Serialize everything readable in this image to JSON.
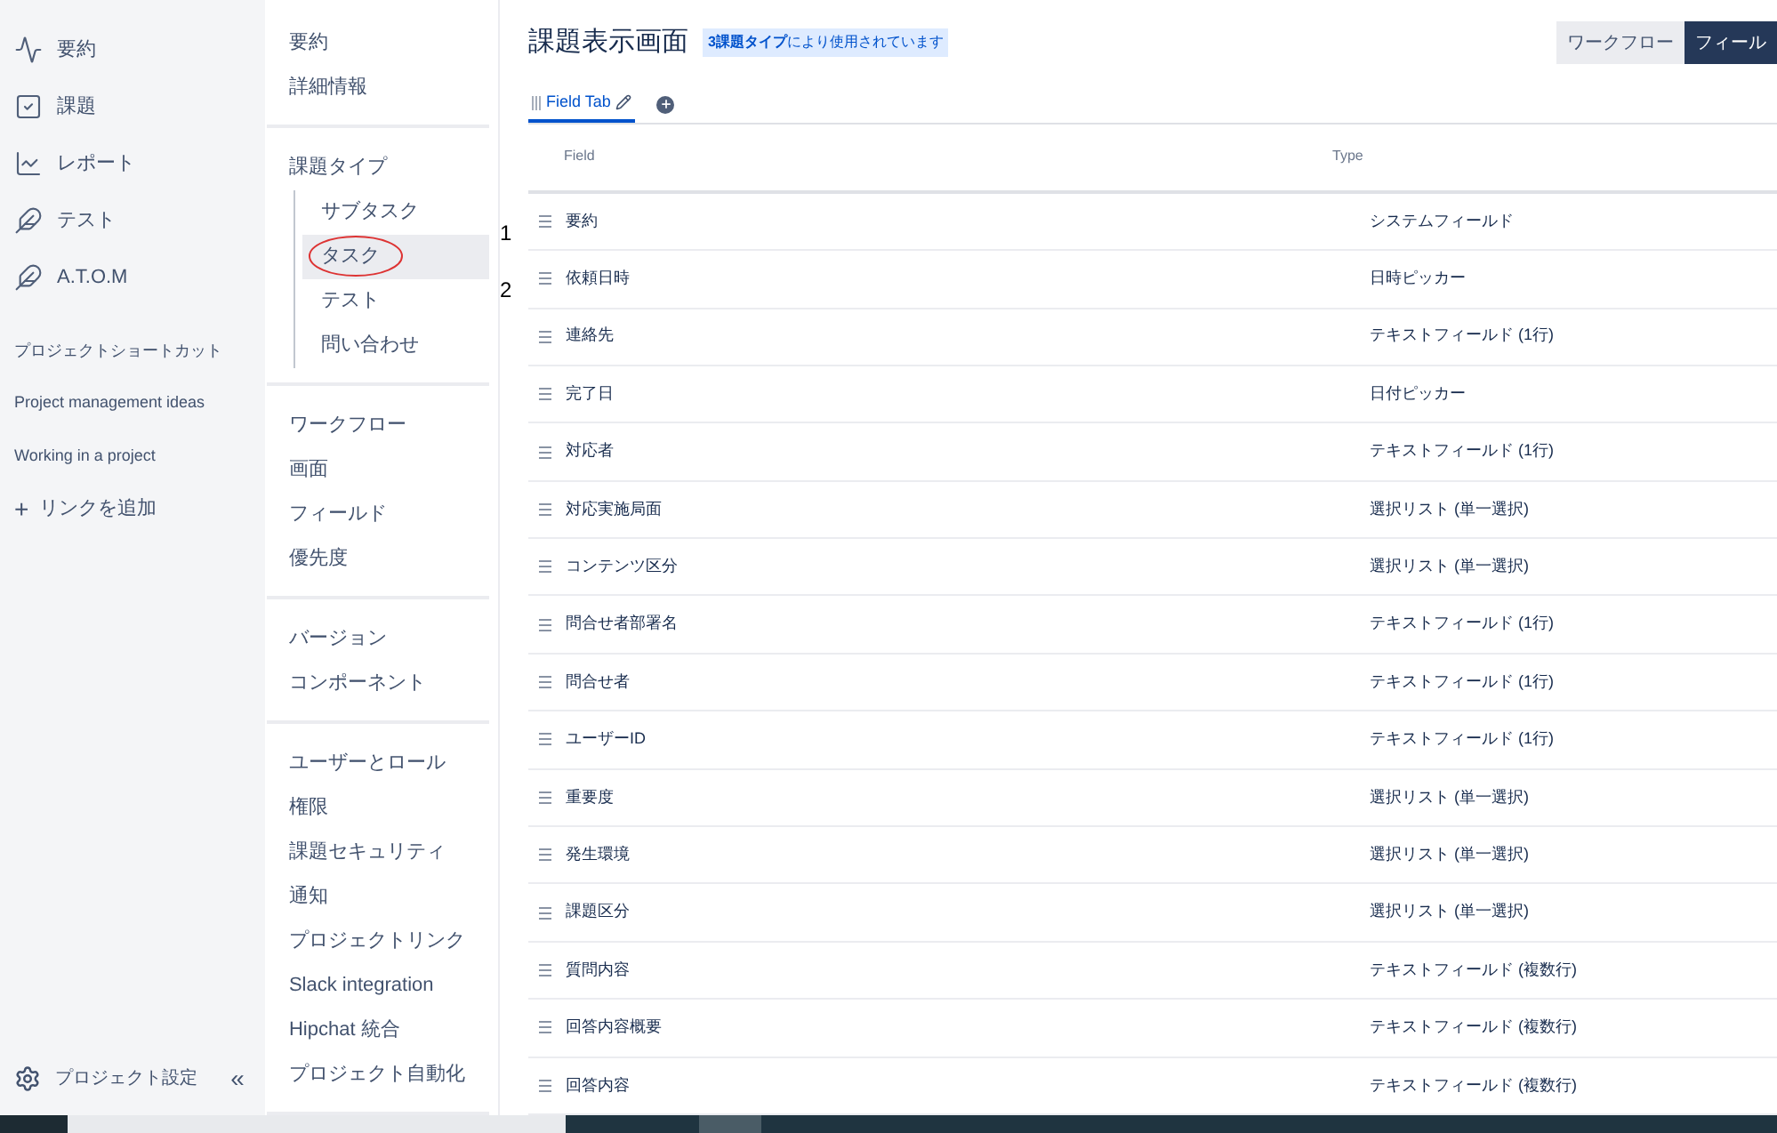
{
  "sidebar": {
    "items": [
      {
        "kind": "summary",
        "label": "要約"
      },
      {
        "kind": "issues",
        "label": "課題"
      },
      {
        "kind": "reports",
        "label": "レポート"
      },
      {
        "kind": "test",
        "label": "テスト"
      },
      {
        "kind": "atom",
        "label": "A.T.O.M"
      }
    ],
    "shortcuts_title": "プロジェクトショートカット",
    "shortcuts": [
      "Project management ideas",
      "Working in a project"
    ],
    "add_link": {
      "icon": "+",
      "label": "リンクを追加"
    },
    "settings": "プロジェクト設定",
    "collapse": "«"
  },
  "settings_nav": {
    "groups": [
      {
        "items": [
          {
            "label": "要約",
            "selected": false
          },
          {
            "label": "詳細情報",
            "selected": false
          }
        ]
      },
      {
        "items": [
          {
            "label": "課題タイプ",
            "selected": false,
            "children": [
              {
                "label": "サブタスク",
                "selected": false,
                "circled": false
              },
              {
                "label": "タスク",
                "selected": true,
                "circled": true
              },
              {
                "label": "テスト",
                "selected": false,
                "circled": false
              },
              {
                "label": "問い合わせ",
                "selected": false,
                "circled": false
              }
            ]
          }
        ]
      },
      {
        "items": [
          {
            "label": "ワークフロー",
            "selected": false
          },
          {
            "label": "画面",
            "selected": false
          },
          {
            "label": "フィールド",
            "selected": false
          },
          {
            "label": "優先度",
            "selected": false
          }
        ]
      },
      {
        "items": [
          {
            "label": "バージョン",
            "selected": false
          },
          {
            "label": "コンポーネント",
            "selected": false
          }
        ]
      },
      {
        "items": [
          {
            "label": "ユーザーとロール",
            "selected": false
          },
          {
            "label": "権限",
            "selected": false
          },
          {
            "label": "課題セキュリティ",
            "selected": false
          },
          {
            "label": "通知",
            "selected": false
          },
          {
            "label": "プロジェクトリンク",
            "selected": false
          },
          {
            "label": "Slack integration",
            "selected": false
          },
          {
            "label": "Hipchat 統合",
            "selected": false
          },
          {
            "label": "プロジェクト自動化",
            "selected": false
          }
        ]
      }
    ]
  },
  "page": {
    "title": "課題表示画面",
    "usage_badge": "**3課題タイプ**により使用されています",
    "view_toggle": [
      {
        "label": "ワークフロー",
        "selected": false
      },
      {
        "label": "フィール",
        "selected": true
      }
    ],
    "tabs": [
      {
        "label": "Field Tab",
        "selected": true
      }
    ],
    "table": {
      "columns": [
        "Field",
        "Type"
      ],
      "rows": [
        {
          "marker": "1",
          "field": "要約",
          "type": "システムフィールド"
        },
        {
          "marker": "2",
          "field": "依頼日時",
          "type": "日時ピッカー"
        },
        {
          "field": "連絡先",
          "type": "テキストフィールド (1行)"
        },
        {
          "field": "完了日",
          "type": "日付ピッカー"
        },
        {
          "field": "対応者",
          "type": "テキストフィールド (1行)"
        },
        {
          "field": "対応実施局面",
          "type": "選択リスト (単一選択)"
        },
        {
          "field": "コンテンツ区分",
          "type": "選択リスト (単一選択)"
        },
        {
          "field": "問合せ者部署名",
          "type": "テキストフィールド (1行)"
        },
        {
          "field": "問合せ者",
          "type": "テキストフィールド (1行)"
        },
        {
          "field": "ユーザーID",
          "type": "テキストフィールド (1行)"
        },
        {
          "field": "重要度",
          "type": "選択リスト (単一選択)"
        },
        {
          "field": "発生環境",
          "type": "選択リスト (単一選択)"
        },
        {
          "field": "課題区分",
          "type": "選択リスト (単一選択)"
        },
        {
          "field": "質問内容",
          "type": "テキストフィールド (複数行)"
        },
        {
          "field": "回答内容概要",
          "type": "テキストフィールド (複数行)"
        },
        {
          "field": "回答内容",
          "type": "テキストフィールド (複数行)"
        }
      ]
    }
  }
}
